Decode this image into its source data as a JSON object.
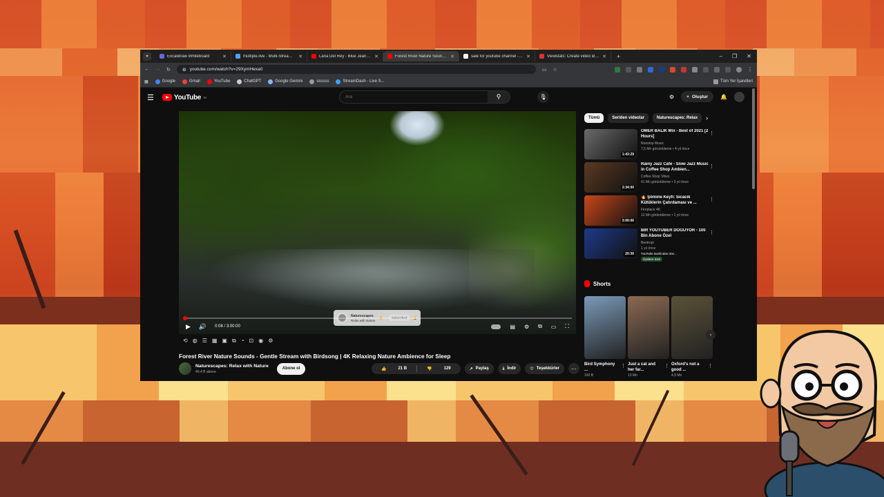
{
  "browser": {
    "tabs": [
      {
        "title": "Excalidraw Whiteboard",
        "color": "#6965db"
      },
      {
        "title": "mutliple.live - Multi-Stream De",
        "color": "#4da3ff"
      },
      {
        "title": "Lana Del Rey - Blue Jeans - You",
        "color": "#ff0000"
      },
      {
        "title": "Forest River Nature Sounds - G",
        "color": "#ff0000"
      },
      {
        "title": "sale for youtube channel - Goo",
        "color": "#ffffff"
      },
      {
        "title": "Viewstats: Create video ideas, t",
        "color": "#e03030"
      }
    ],
    "url": "youtube.com/watch?v=29XymHexa0",
    "bookmarks": [
      {
        "label": "Google",
        "color": "#4285f4"
      },
      {
        "label": "Gmail",
        "color": "#ea4335"
      },
      {
        "label": "YouTube",
        "color": "#ff0000"
      },
      {
        "label": "ChatGPT",
        "color": "#cccccc"
      },
      {
        "label": "Google Gemini",
        "color": "#8ab4f8"
      },
      {
        "label": "ssssss",
        "color": "#999999"
      },
      {
        "label": "StreamDash - Live S...",
        "color": "#3ba3ff"
      }
    ],
    "bookmarks_right": "Tüm Yer İşaretleri"
  },
  "youtube": {
    "logo_text": "YouTube",
    "logo_sup": "TR",
    "search_placeholder": "Ara",
    "create_label": "Oluştur",
    "player": {
      "time": "0:08 / 3:00:00",
      "overlay_channel": "Naturescapes",
      "overlay_sub": "Relax with Nature",
      "overlay_button": "Subscribed"
    },
    "video_title": "Forest River Nature Sounds - Gentle Stream with Birdsong | 4K Relaxing Nature Ambience for Sleep",
    "channel_name": "Naturescapes: Relax with Nature",
    "channel_subs": "40,4 B abone",
    "subscribe_label": "Abone ol",
    "likes": "21 B",
    "dislikes": "129",
    "share_label": "Paylaş",
    "download_label": "İndir",
    "thanks_label": "Teşekkürler",
    "chips": [
      "Tümü",
      "Seriden videolar",
      "Naturescapes: Relax"
    ],
    "recommendations": [
      {
        "title": "OMER BALIK Mix - Best of 2021 [2 Hours]",
        "channel": "Nonstop Music",
        "stats": "7,5 Mn görüntüleme • 4 yıl önce",
        "duration": "1:43:29",
        "thumb": "#6a6a6a"
      },
      {
        "title": "Rainy Jazz Cafe - Slow Jazz Music in Coffee Shop Ambien...",
        "channel": "Coffee Shop Vibes",
        "stats": "41 Mn görüntüleme • 3 yıl önce",
        "duration": "3:34:00",
        "thumb": "#5a3a22"
      },
      {
        "title": "🔥 Şömine Keyfi: Sıcacık Kütüklerin Çatırdaması ve ...",
        "channel": "Fireplace 4K",
        "stats": "12 Mn görüntüleme • 1 yıl önce",
        "duration": "3:00:06",
        "thumb": "#c8481a"
      },
      {
        "title": "BİR YOUTUBER DOĞUYOR - 100 Bin Abone Özel",
        "channel": "Bentropi",
        "stats": "1 yıl önce",
        "duration": "20:36",
        "thumb": "#1e3a8a",
        "extra": "YouTube tarafından öne...",
        "tag": "Üyelere özel"
      }
    ],
    "shorts_heading": "Shorts",
    "shorts": [
      {
        "title": "Bird Symphony ...",
        "views": "192 B",
        "thumb": "#7a9ab8"
      },
      {
        "title": "Just a cat and her far...",
        "views": "13 Mn",
        "thumb": "#8a6a52"
      },
      {
        "title": "Oxford's not a good ...",
        "views": "4,9 Mn",
        "thumb": "#5a5238"
      }
    ]
  }
}
